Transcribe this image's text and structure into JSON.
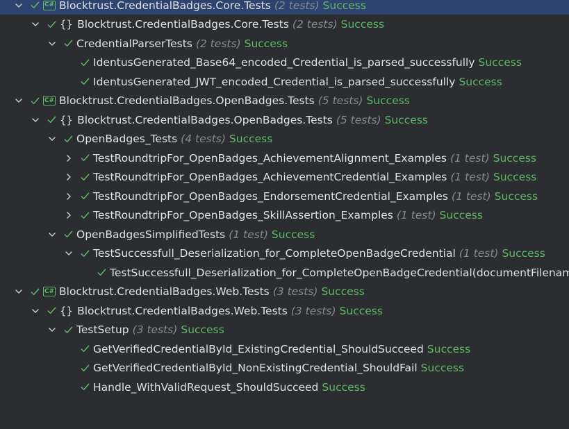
{
  "colors": {
    "background": "#2b2d30",
    "selection": "#2e436e",
    "success": "#5fb865",
    "text": "#dfe1e5",
    "muted": "#868a91"
  },
  "tree": [
    {
      "level": 0,
      "expander": "expanded",
      "icon": "csharp-project-icon",
      "icon_text": "C#",
      "name": "Blocktrust.CredentialBadges.Core.Tests",
      "count": "(2 tests)",
      "status": "Success",
      "selected": true
    },
    {
      "level": 1,
      "expander": "expanded",
      "icon": "namespace-icon",
      "icon_text": "{}",
      "name": "Blocktrust.CredentialBadges.Core.Tests",
      "count": "(2 tests)",
      "status": "Success"
    },
    {
      "level": 2,
      "expander": "expanded",
      "icon": "",
      "icon_text": "",
      "name": "CredentialParserTests",
      "count": "(2 tests)",
      "status": "Success"
    },
    {
      "level": 3,
      "expander": "none",
      "icon": "",
      "icon_text": "",
      "name": "IdentusGenerated_Base64_encoded_Credential_is_parsed_successfully",
      "count": "",
      "status": "Success"
    },
    {
      "level": 3,
      "expander": "none",
      "icon": "",
      "icon_text": "",
      "name": "IdentusGenerated_JWT_encoded_Credential_is_parsed_successfully",
      "count": "",
      "status": "Success"
    },
    {
      "level": 0,
      "expander": "expanded",
      "icon": "csharp-project-icon",
      "icon_text": "C#",
      "name": "Blocktrust.CredentialBadges.OpenBadges.Tests",
      "count": "(5 tests)",
      "status": "Success"
    },
    {
      "level": 1,
      "expander": "expanded",
      "icon": "namespace-icon",
      "icon_text": "{}",
      "name": "Blocktrust.CredentialBadges.OpenBadges.Tests",
      "count": "(5 tests)",
      "status": "Success"
    },
    {
      "level": 2,
      "expander": "expanded",
      "icon": "",
      "icon_text": "",
      "name": "OpenBadges_Tests",
      "count": "(4 tests)",
      "status": "Success"
    },
    {
      "level": 3,
      "expander": "collapsed",
      "icon": "",
      "icon_text": "",
      "name": "TestRoundtripFor_OpenBadges_AchievementAlignment_Examples",
      "count": "(1 test)",
      "status": "Success"
    },
    {
      "level": 3,
      "expander": "collapsed",
      "icon": "",
      "icon_text": "",
      "name": "TestRoundtripFor_OpenBadges_AchievementCredential_Examples",
      "count": "(1 test)",
      "status": "Success"
    },
    {
      "level": 3,
      "expander": "collapsed",
      "icon": "",
      "icon_text": "",
      "name": "TestRoundtripFor_OpenBadges_EndorsementCredential_Examples",
      "count": "(1 test)",
      "status": "Success"
    },
    {
      "level": 3,
      "expander": "collapsed",
      "icon": "",
      "icon_text": "",
      "name": "TestRoundtripFor_OpenBadges_SkillAssertion_Examples",
      "count": "(1 test)",
      "status": "Success"
    },
    {
      "level": 2,
      "expander": "expanded",
      "icon": "",
      "icon_text": "",
      "name": "OpenBadgesSimplifiedTests",
      "count": "(1 test)",
      "status": "Success"
    },
    {
      "level": 3,
      "expander": "expanded",
      "icon": "",
      "icon_text": "",
      "name": "TestSuccessfull_Deserialization_for_CompleteOpenBadgeCredential",
      "count": "(1 test)",
      "status": "Success"
    },
    {
      "level": 4,
      "expander": "none",
      "icon": "",
      "icon_text": "",
      "name": "TestSuccessfull_Deserialization_for_CompleteOpenBadgeCredential(documentFilenam",
      "count": "",
      "status": ""
    },
    {
      "level": 0,
      "expander": "expanded",
      "icon": "csharp-project-icon",
      "icon_text": "C#",
      "name": "Blocktrust.CredentialBadges.Web.Tests",
      "count": "(3 tests)",
      "status": "Success"
    },
    {
      "level": 1,
      "expander": "expanded",
      "icon": "namespace-icon",
      "icon_text": "{}",
      "name": "Blocktrust.CredentialBadges.Web.Tests",
      "count": "(3 tests)",
      "status": "Success"
    },
    {
      "level": 2,
      "expander": "expanded",
      "icon": "",
      "icon_text": "",
      "name": "TestSetup",
      "count": "(3 tests)",
      "status": "Success"
    },
    {
      "level": 3,
      "expander": "none",
      "icon": "",
      "icon_text": "",
      "name": "GetVerifiedCredentialById_ExistingCredential_ShouldSucceed",
      "count": "",
      "status": "Success"
    },
    {
      "level": 3,
      "expander": "none",
      "icon": "",
      "icon_text": "",
      "name": "GetVerifiedCredentialById_NonExistingCredential_ShouldFail",
      "count": "",
      "status": "Success"
    },
    {
      "level": 3,
      "expander": "none",
      "icon": "",
      "icon_text": "",
      "name": "Handle_WithValidRequest_ShouldSucceed",
      "count": "",
      "status": "Success"
    }
  ]
}
